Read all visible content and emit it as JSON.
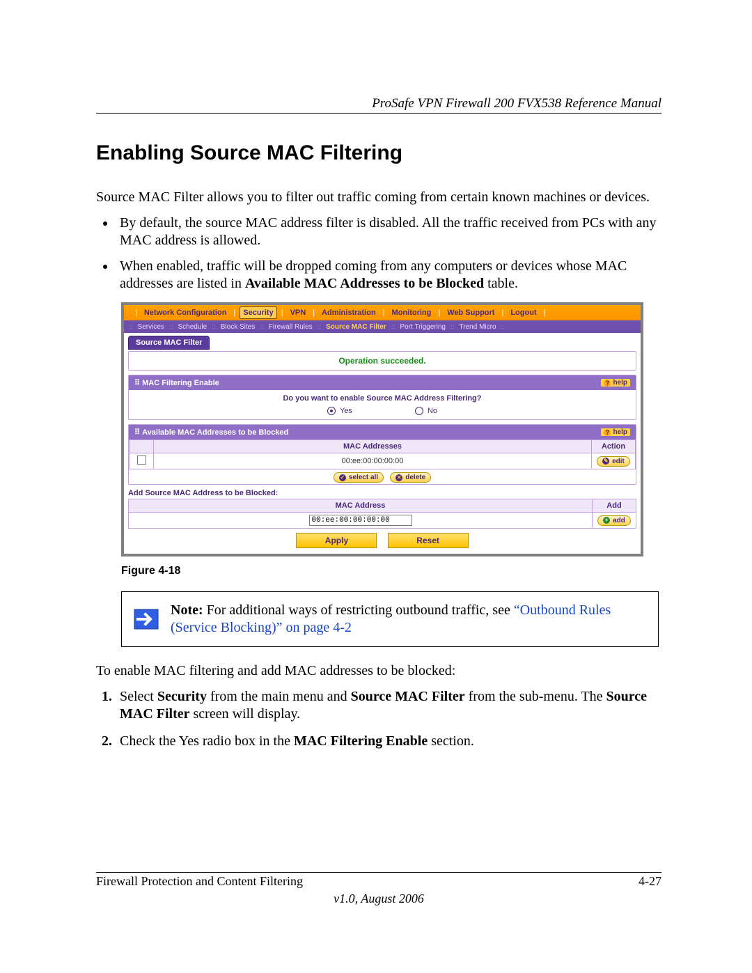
{
  "header": {
    "running_head": "ProSafe VPN Firewall 200 FVX538 Reference Manual"
  },
  "section": {
    "title": "Enabling Source MAC Filtering",
    "intro": "Source MAC Filter allows you to filter out traffic coming from certain known machines or devices.",
    "bullets": {
      "b1": "By default, the source MAC address filter is disabled. All the traffic received from PCs with any MAC address is allowed.",
      "b2_pre": "When enabled, traffic will be dropped coming from any computers or devices whose MAC addresses are listed in ",
      "b2_bold": "Available MAC Addresses to be Blocked",
      "b2_post": " table."
    }
  },
  "ui": {
    "main_nav": [
      "Network Configuration",
      "Security",
      "VPN",
      "Administration",
      "Monitoring",
      "Web Support",
      "Logout"
    ],
    "main_nav_active_index": 1,
    "sub_nav": [
      "Services",
      "Schedule",
      "Block Sites",
      "Firewall Rules",
      "Source MAC Filter",
      "Port Triggering",
      "Trend Micro"
    ],
    "sub_nav_active_index": 4,
    "tab_label": "Source MAC Filter",
    "status_msg": "Operation succeeded.",
    "panel1": {
      "title": "MAC Filtering Enable",
      "help": "help",
      "question": "Do you want to enable Source MAC Address Filtering?",
      "yes": "Yes",
      "no": "No"
    },
    "panel2": {
      "title": "Available MAC Addresses to be Blocked",
      "help": "help",
      "col_addr": "MAC Addresses",
      "col_action": "Action",
      "row_mac": "00:ee:00:00:00:00",
      "edit_btn": "edit",
      "select_all": "select all",
      "delete": "delete"
    },
    "add": {
      "title": "Add Source MAC Address to be Blocked:",
      "col_addr": "MAC Address",
      "col_add": "Add",
      "input_value": "00:ee:00:00:00:00",
      "add_btn": "add"
    },
    "apply": "Apply",
    "reset": "Reset"
  },
  "figure_caption": "Figure 4-18",
  "note": {
    "bold": "Note:",
    "text": " For additional ways of restricting outbound traffic, see ",
    "link": "“Outbound Rules (Service Blocking)” on page 4-2"
  },
  "after_note": "To enable MAC filtering and add MAC addresses to be blocked:",
  "steps": {
    "s1_a": "Select ",
    "s1_b": "Security",
    "s1_c": " from the main menu and ",
    "s1_d": "Source MAC Filter",
    "s1_e": " from the sub-menu. The ",
    "s1_f": "Source MAC Filter",
    "s1_g": " screen will display.",
    "s2_a": "Check the Yes radio box in the ",
    "s2_b": "MAC Filtering Enable",
    "s2_c": " section."
  },
  "footer": {
    "left": "Firewall Protection and Content Filtering",
    "right": "4-27",
    "version": "v1.0, August 2006"
  }
}
